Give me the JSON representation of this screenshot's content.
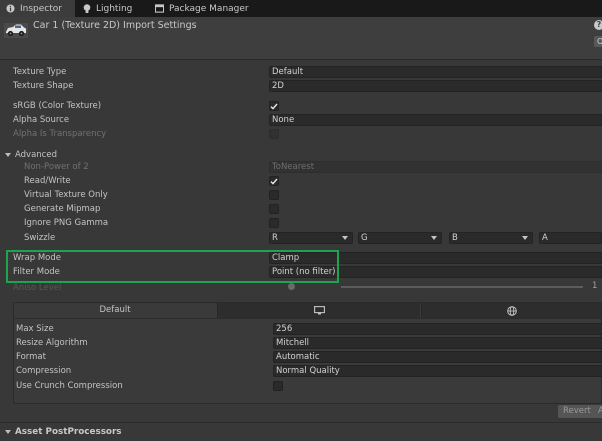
{
  "tabs": [
    {
      "label": "Inspector",
      "icon": "info-icon"
    },
    {
      "label": "Lighting",
      "icon": "lightbulb-icon"
    },
    {
      "label": "Package Manager",
      "icon": "package-icon"
    }
  ],
  "header": {
    "title": "Car 1 (Texture 2D) Import Settings",
    "help_glyph": "?",
    "open_partial": "O"
  },
  "texture_type": {
    "label": "Texture Type",
    "value": "Default"
  },
  "texture_shape": {
    "label": "Texture Shape",
    "value": "2D"
  },
  "srgb": {
    "label": "sRGB (Color Texture)",
    "checked": true
  },
  "alpha_source": {
    "label": "Alpha Source",
    "value": "None"
  },
  "alpha_transparency": {
    "label": "Alpha Is Transparency",
    "checked": false,
    "disabled": true
  },
  "advanced": {
    "label": "Advanced",
    "non_power": {
      "label": "Non-Power of 2",
      "value": "ToNearest",
      "disabled": true
    },
    "read_write": {
      "label": "Read/Write",
      "checked": true
    },
    "virtual_texture": {
      "label": "Virtual Texture Only",
      "checked": false
    },
    "mipmap": {
      "label": "Generate Mipmap",
      "checked": false
    },
    "ignore_png_gamma": {
      "label": "Ignore PNG Gamma",
      "checked": false
    },
    "swizzle": {
      "label": "Swizzle",
      "channels": [
        "R",
        "G",
        "B",
        "A"
      ]
    }
  },
  "wrap_mode": {
    "label": "Wrap Mode",
    "value": "Clamp"
  },
  "filter_mode": {
    "label": "Filter Mode",
    "value": "Point (no filter)"
  },
  "aniso_level": {
    "label": "Aniso Level",
    "value": "1",
    "slider_fraction": 0.0
  },
  "platform_tabs": [
    {
      "label": "Default",
      "active": true
    },
    {
      "icon": "monitor-icon"
    },
    {
      "icon": "globe-icon"
    }
  ],
  "max_size": {
    "label": "Max Size",
    "value": "256"
  },
  "resize_algorithm": {
    "label": "Resize Algorithm",
    "value": "Mitchell"
  },
  "format": {
    "label": "Format",
    "value": "Automatic"
  },
  "compression": {
    "label": "Compression",
    "value": "Normal Quality"
  },
  "crunch": {
    "label": "Use Crunch Compression",
    "checked": false
  },
  "buttons": {
    "revert": "Revert",
    "apply_partial": "A"
  },
  "post_processors": {
    "label": "Asset PostProcessors"
  },
  "colors": {
    "highlight": "#1aa64f",
    "background": "#383838",
    "field": "#2a2a2a"
  }
}
